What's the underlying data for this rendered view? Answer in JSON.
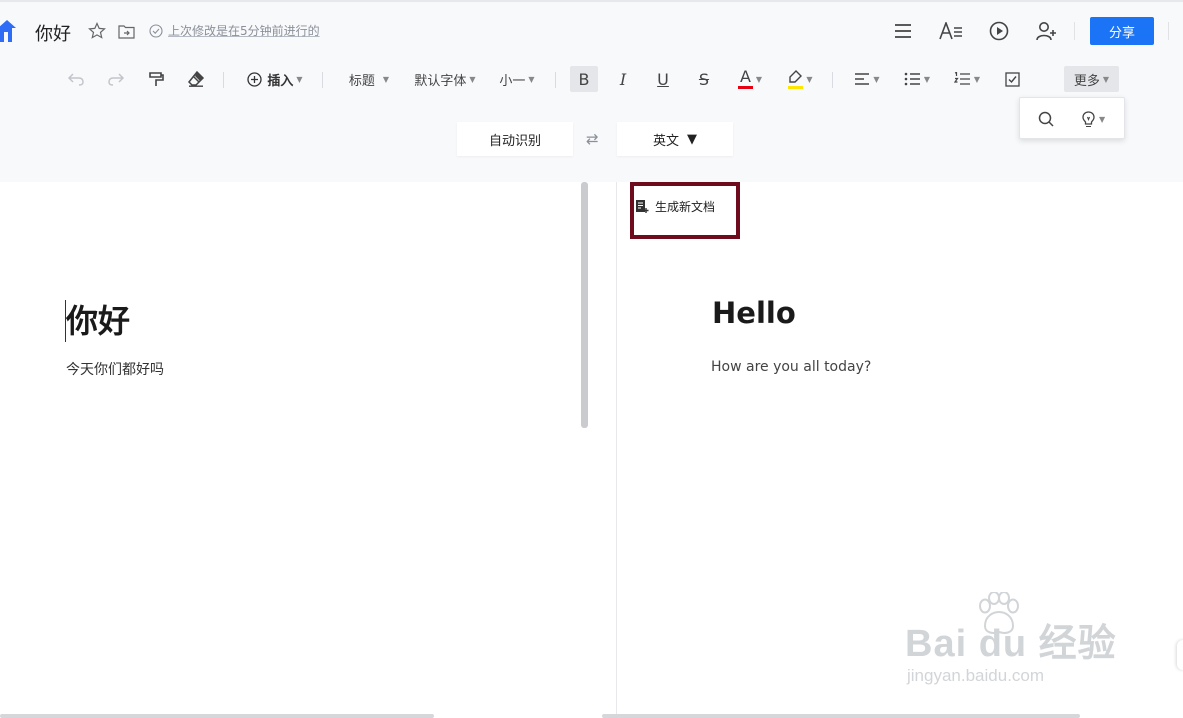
{
  "header": {
    "title": "你好",
    "status_text": "上次修改是在5分钟前进行的",
    "share_label": "分享"
  },
  "toolbar": {
    "insert_label": "插入",
    "heading_label": "标题",
    "font_label": "默认字体",
    "size_label": "小一",
    "bold_glyph": "B",
    "italic_glyph": "I",
    "underline_glyph": "U",
    "strike_glyph": "S",
    "font_color_glyph": "A",
    "more_label": "更多",
    "font_color": "#e60012",
    "highlight_color": "#ffe600"
  },
  "translate": {
    "source_lang": "自动识别",
    "target_lang": "英文"
  },
  "generate_doc_label": "生成新文档",
  "source_doc": {
    "heading": "你好",
    "body": "今天你们都好吗"
  },
  "translated_doc": {
    "heading": "Hello",
    "body": "How are you all today?"
  },
  "watermark": {
    "brand": "Bai du 经验",
    "url": "jingyan.baidu.com"
  },
  "colors": {
    "accent": "#1a74f5",
    "highlight_box": "#6e0b1d"
  }
}
